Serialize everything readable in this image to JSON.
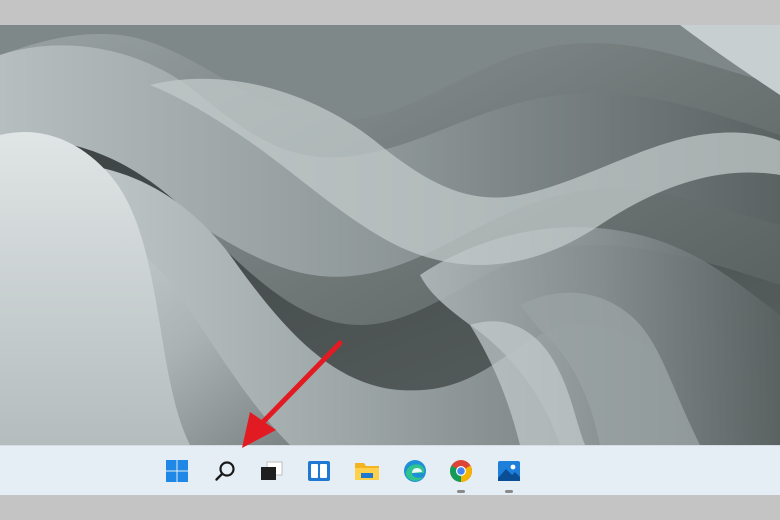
{
  "screen": {
    "wallpaper": "windows-11-flow-wallpaper-gray"
  },
  "taskbar": {
    "background": "#e6eef5",
    "icons": [
      {
        "name": "start-icon",
        "running": false
      },
      {
        "name": "search-icon",
        "running": false
      },
      {
        "name": "task-view-icon",
        "running": false
      },
      {
        "name": "widgets-icon",
        "running": false
      },
      {
        "name": "file-explorer-icon",
        "running": false
      },
      {
        "name": "edge-icon",
        "running": false
      },
      {
        "name": "chrome-icon",
        "running": true
      },
      {
        "name": "photos-icon",
        "running": true
      }
    ]
  },
  "annotation": {
    "type": "arrow",
    "color": "#e21b23",
    "points_to": "search-icon"
  }
}
